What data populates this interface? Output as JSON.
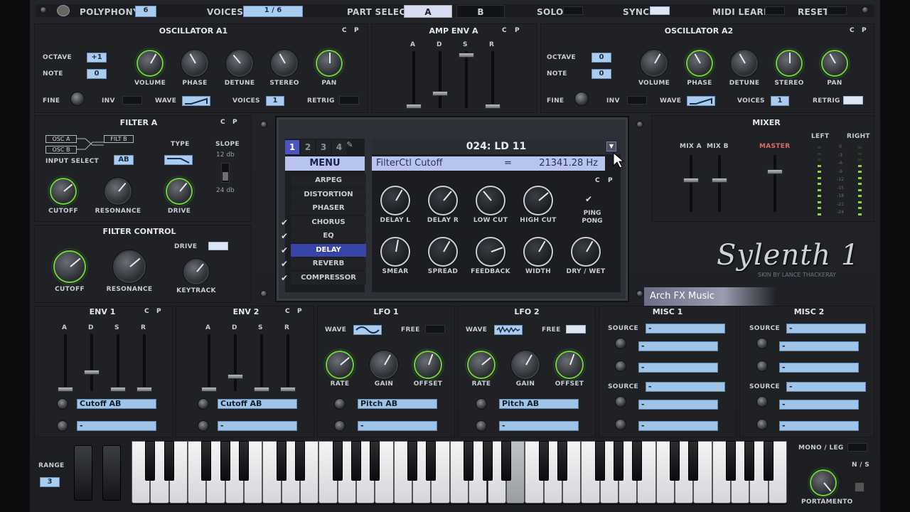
{
  "topbar": {
    "polyphony_label": "POLYPHONY",
    "polyphony_value": "6",
    "voices_label": "VOICES",
    "voices_value": "1 / 6",
    "part_select_label": "PART SELECT",
    "part_a": "A",
    "part_b": "B",
    "solo_label": "SOLO",
    "sync_label": "SYNC",
    "midi_learn_label": "MIDI LEARN",
    "reset_label": "RESET"
  },
  "osc_a1": {
    "title": "OSCILLATOR A1",
    "c": "C",
    "p": "P",
    "octave_label": "OCTAVE",
    "octave_value": "+1",
    "note_label": "NOTE",
    "note_value": "0",
    "fine_label": "FINE",
    "inv_label": "INV",
    "wave_label": "WAVE",
    "voices_label": "VOICES",
    "voices_value": "1",
    "retrig_label": "RETRIG",
    "knobs": [
      "VOLUME",
      "PHASE",
      "DETUNE",
      "STEREO",
      "PAN"
    ]
  },
  "amp_env": {
    "title": "AMP ENV A",
    "c": "C",
    "p": "P",
    "adsr": [
      "A",
      "D",
      "S",
      "R"
    ]
  },
  "osc_a2": {
    "title": "OSCILLATOR A2",
    "c": "C",
    "p": "P",
    "octave_label": "OCTAVE",
    "octave_value": "0",
    "note_label": "NOTE",
    "note_value": "0",
    "fine_label": "FINE",
    "inv_label": "INV",
    "wave_label": "WAVE",
    "voices_label": "VOICES",
    "voices_value": "1",
    "retrig_label": "RETRIG",
    "knobs": [
      "VOLUME",
      "PHASE",
      "DETUNE",
      "STEREO",
      "PAN"
    ]
  },
  "filter_a": {
    "title": "FILTER A",
    "c": "C",
    "p": "P",
    "osc_a": "OSC A",
    "osc_b": "OSC B",
    "filt_b": "FILT B",
    "input_select_label": "INPUT SELECT",
    "input_select_value": "AB",
    "type_label": "TYPE",
    "slope_label": "SLOPE",
    "slope_12": "12 db",
    "slope_24": "24 db",
    "knobs": [
      "CUTOFF",
      "RESONANCE",
      "DRIVE"
    ]
  },
  "filter_control": {
    "title": "FILTER CONTROL",
    "drive_label": "DRIVE",
    "knobs": [
      "CUTOFF",
      "RESONANCE",
      "KEYTRACK"
    ]
  },
  "display": {
    "tabs": [
      "1",
      "2",
      "3",
      "4"
    ],
    "preset": "024: LD 11",
    "menu_label": "MENU",
    "param_name": "FilterCtl Cutoff",
    "param_eq": "=",
    "param_value": "21341.28 Hz",
    "fx": [
      "ARPEG",
      "DISTORTION",
      "PHASER",
      "CHORUS",
      "EQ",
      "DELAY",
      "REVERB",
      "COMPRESSOR"
    ],
    "fx_checked": [
      false,
      false,
      false,
      true,
      true,
      true,
      true,
      true
    ],
    "c": "C",
    "p": "P",
    "delay_knobs_row1": [
      "DELAY L",
      "DELAY R",
      "LOW CUT",
      "HIGH CUT"
    ],
    "ping_pong": "PING PONG",
    "delay_knobs_row2": [
      "SMEAR",
      "SPREAD",
      "FEEDBACK",
      "WIDTH",
      "DRY / WET"
    ]
  },
  "mixer": {
    "title": "MIXER",
    "mix_a": "MIX A",
    "mix_b": "MIX B",
    "master": "MASTER",
    "left": "LEFT",
    "right": "RIGHT",
    "scale": [
      "0",
      "-3",
      "-6",
      "-9",
      "-12",
      "-15",
      "-18",
      "-21",
      "-24"
    ]
  },
  "logo": {
    "name": "Sylenth 1",
    "skin": "SKIN BY LANCE THACKERAY",
    "overlay": "Arch FX Music"
  },
  "env1": {
    "title": "ENV 1",
    "c": "C",
    "p": "P",
    "adsr": [
      "A",
      "D",
      "S",
      "R"
    ],
    "dest1": "Cutoff AB",
    "dest2": "-"
  },
  "env2": {
    "title": "ENV 2",
    "c": "C",
    "p": "P",
    "adsr": [
      "A",
      "D",
      "S",
      "R"
    ],
    "dest1": "Cutoff AB",
    "dest2": "-"
  },
  "lfo1": {
    "title": "LFO 1",
    "wave_label": "WAVE",
    "free_label": "FREE",
    "knobs": [
      "RATE",
      "GAIN",
      "OFFSET"
    ],
    "dest1": "Pitch AB",
    "dest2": "-"
  },
  "lfo2": {
    "title": "LFO 2",
    "wave_label": "WAVE",
    "free_label": "FREE",
    "knobs": [
      "RATE",
      "GAIN",
      "OFFSET"
    ],
    "dest1": "Pitch AB",
    "dest2": "-"
  },
  "misc1": {
    "title": "MISC 1",
    "source_label": "SOURCE",
    "dash": "-"
  },
  "misc2": {
    "title": "MISC 2",
    "source_label": "SOURCE",
    "dash": "-"
  },
  "keyboard": {
    "range_label": "RANGE",
    "range_value": "3",
    "mono_leg": "MONO / LEG",
    "ns": "N / S",
    "portamento": "PORTAMENTO"
  },
  "colors": {
    "accent_green": "#6fd13a",
    "lcd_blue": "#a9cdf0",
    "menu_active": "#3944a8"
  }
}
